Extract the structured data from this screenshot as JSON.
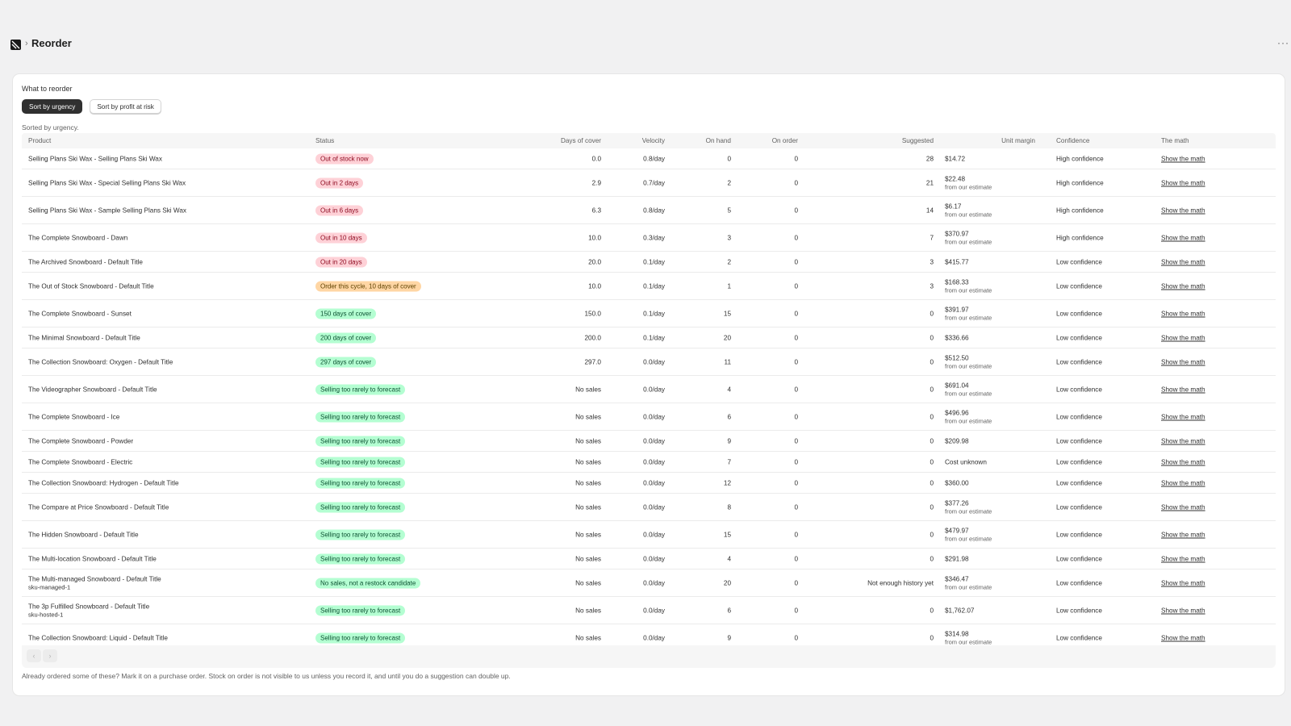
{
  "header": {
    "title": "Reorder",
    "separator": "›",
    "more": "···"
  },
  "card": {
    "title": "What to reorder",
    "sort_buttons": [
      "Sort by urgency",
      "Sort by profit at risk"
    ],
    "sorted_note": "Sorted by urgency.",
    "footer_note": "Already ordered some of these? Mark it on a purchase order. Stock on order is not visible to us unless you record it, and until you do a suggestion can double up."
  },
  "table": {
    "headers": {
      "product": "Product",
      "status": "Status",
      "days": "Days of cover",
      "velocity": "Velocity",
      "on_hand": "On hand",
      "on_order": "On order",
      "suggested": "Suggested",
      "margin": "Unit margin",
      "confidence": "Confidence",
      "math": "The math"
    },
    "rows": [
      {
        "product": "Selling Plans Ski Wax - Selling Plans Ski Wax",
        "sku": "",
        "status": "Out of stock now",
        "tone": "red",
        "days": "0.0",
        "velocity": "0.8/day",
        "on_hand": "0",
        "on_order": "0",
        "suggested": "28",
        "margin": "$14.72",
        "margin_sub": "",
        "confidence": "High confidence",
        "math": "Show the math"
      },
      {
        "product": "Selling Plans Ski Wax - Special Selling Plans Ski Wax",
        "sku": "",
        "status": "Out in 2 days",
        "tone": "red",
        "days": "2.9",
        "velocity": "0.7/day",
        "on_hand": "2",
        "on_order": "0",
        "suggested": "21",
        "margin": "$22.48",
        "margin_sub": "from our estimate",
        "confidence": "High confidence",
        "math": "Show the math"
      },
      {
        "product": "Selling Plans Ski Wax - Sample Selling Plans Ski Wax",
        "sku": "",
        "status": "Out in 6 days",
        "tone": "red",
        "days": "6.3",
        "velocity": "0.8/day",
        "on_hand": "5",
        "on_order": "0",
        "suggested": "14",
        "margin": "$6.17",
        "margin_sub": "from our estimate",
        "confidence": "High confidence",
        "math": "Show the math"
      },
      {
        "product": "The Complete Snowboard - Dawn",
        "sku": "",
        "status": "Out in 10 days",
        "tone": "red",
        "days": "10.0",
        "velocity": "0.3/day",
        "on_hand": "3",
        "on_order": "0",
        "suggested": "7",
        "margin": "$370.97",
        "margin_sub": "from our estimate",
        "confidence": "High confidence",
        "math": "Show the math"
      },
      {
        "product": "The Archived Snowboard - Default Title",
        "sku": "",
        "status": "Out in 20 days",
        "tone": "red",
        "days": "20.0",
        "velocity": "0.1/day",
        "on_hand": "2",
        "on_order": "0",
        "suggested": "3",
        "margin": "$415.77",
        "margin_sub": "",
        "confidence": "Low confidence",
        "math": "Show the math"
      },
      {
        "product": "The Out of Stock Snowboard - Default Title",
        "sku": "",
        "status": "Order this cycle, 10 days of cover",
        "tone": "orange",
        "days": "10.0",
        "velocity": "0.1/day",
        "on_hand": "1",
        "on_order": "0",
        "suggested": "3",
        "margin": "$168.33",
        "margin_sub": "from our estimate",
        "confidence": "Low confidence",
        "math": "Show the math"
      },
      {
        "product": "The Complete Snowboard - Sunset",
        "sku": "",
        "status": "150 days of cover",
        "tone": "green",
        "days": "150.0",
        "velocity": "0.1/day",
        "on_hand": "15",
        "on_order": "0",
        "suggested": "0",
        "margin": "$391.97",
        "margin_sub": "from our estimate",
        "confidence": "Low confidence",
        "math": "Show the math"
      },
      {
        "product": "The Minimal Snowboard - Default Title",
        "sku": "",
        "status": "200 days of cover",
        "tone": "green",
        "days": "200.0",
        "velocity": "0.1/day",
        "on_hand": "20",
        "on_order": "0",
        "suggested": "0",
        "margin": "$336.66",
        "margin_sub": "",
        "confidence": "Low confidence",
        "math": "Show the math"
      },
      {
        "product": "The Collection Snowboard: Oxygen - Default Title",
        "sku": "",
        "status": "297 days of cover",
        "tone": "green",
        "days": "297.0",
        "velocity": "0.0/day",
        "on_hand": "11",
        "on_order": "0",
        "suggested": "0",
        "margin": "$512.50",
        "margin_sub": "from our estimate",
        "confidence": "Low confidence",
        "math": "Show the math"
      },
      {
        "product": "The Videographer Snowboard - Default Title",
        "sku": "",
        "status": "Selling too rarely to forecast",
        "tone": "green",
        "days": "No sales",
        "velocity": "0.0/day",
        "on_hand": "4",
        "on_order": "0",
        "suggested": "0",
        "margin": "$691.04",
        "margin_sub": "from our estimate",
        "confidence": "Low confidence",
        "math": "Show the math"
      },
      {
        "product": "The Complete Snowboard - Ice",
        "sku": "",
        "status": "Selling too rarely to forecast",
        "tone": "green",
        "days": "No sales",
        "velocity": "0.0/day",
        "on_hand": "6",
        "on_order": "0",
        "suggested": "0",
        "margin": "$496.96",
        "margin_sub": "from our estimate",
        "confidence": "Low confidence",
        "math": "Show the math"
      },
      {
        "product": "The Complete Snowboard - Powder",
        "sku": "",
        "status": "Selling too rarely to forecast",
        "tone": "green",
        "days": "No sales",
        "velocity": "0.0/day",
        "on_hand": "9",
        "on_order": "0",
        "suggested": "0",
        "margin": "$209.98",
        "margin_sub": "",
        "confidence": "Low confidence",
        "math": "Show the math"
      },
      {
        "product": "The Complete Snowboard - Electric",
        "sku": "",
        "status": "Selling too rarely to forecast",
        "tone": "green",
        "days": "No sales",
        "velocity": "0.0/day",
        "on_hand": "7",
        "on_order": "0",
        "suggested": "0",
        "margin": "Cost unknown",
        "margin_sub": "",
        "confidence": "Low confidence",
        "math": "Show the math"
      },
      {
        "product": "The Collection Snowboard: Hydrogen - Default Title",
        "sku": "",
        "status": "Selling too rarely to forecast",
        "tone": "green",
        "days": "No sales",
        "velocity": "0.0/day",
        "on_hand": "12",
        "on_order": "0",
        "suggested": "0",
        "margin": "$360.00",
        "margin_sub": "",
        "confidence": "Low confidence",
        "math": "Show the math"
      },
      {
        "product": "The Compare at Price Snowboard - Default Title",
        "sku": "",
        "status": "Selling too rarely to forecast",
        "tone": "green",
        "days": "No sales",
        "velocity": "0.0/day",
        "on_hand": "8",
        "on_order": "0",
        "suggested": "0",
        "margin": "$377.26",
        "margin_sub": "from our estimate",
        "confidence": "Low confidence",
        "math": "Show the math"
      },
      {
        "product": "The Hidden Snowboard - Default Title",
        "sku": "",
        "status": "Selling too rarely to forecast",
        "tone": "green",
        "days": "No sales",
        "velocity": "0.0/day",
        "on_hand": "15",
        "on_order": "0",
        "suggested": "0",
        "margin": "$479.97",
        "margin_sub": "from our estimate",
        "confidence": "Low confidence",
        "math": "Show the math"
      },
      {
        "product": "The Multi-location Snowboard - Default Title",
        "sku": "",
        "status": "Selling too rarely to forecast",
        "tone": "green",
        "days": "No sales",
        "velocity": "0.0/day",
        "on_hand": "4",
        "on_order": "0",
        "suggested": "0",
        "margin": "$291.98",
        "margin_sub": "",
        "confidence": "Low confidence",
        "math": "Show the math"
      },
      {
        "product": "The Multi-managed Snowboard - Default Title",
        "sku": "sku-managed-1",
        "status": "No sales, not a restock candidate",
        "tone": "green",
        "days": "No sales",
        "velocity": "0.0/day",
        "on_hand": "20",
        "on_order": "0",
        "suggested": "Not enough history yet",
        "margin": "$346.47",
        "margin_sub": "from our estimate",
        "confidence": "Low confidence",
        "math": "Show the math"
      },
      {
        "product": "The 3p Fulfilled Snowboard - Default Title",
        "sku": "sku-hosted-1",
        "status": "Selling too rarely to forecast",
        "tone": "green",
        "days": "No sales",
        "velocity": "0.0/day",
        "on_hand": "6",
        "on_order": "0",
        "suggested": "0",
        "margin": "$1,762.07",
        "margin_sub": "",
        "confidence": "Low confidence",
        "math": "Show the math"
      },
      {
        "product": "The Collection Snowboard: Liquid - Default Title",
        "sku": "",
        "status": "Selling too rarely to forecast",
        "tone": "green",
        "days": "No sales",
        "velocity": "0.0/day",
        "on_hand": "9",
        "on_order": "0",
        "suggested": "0",
        "margin": "$314.98",
        "margin_sub": "from our estimate",
        "confidence": "Low confidence",
        "math": "Show the math"
      }
    ]
  },
  "pagination": {
    "prev": "‹",
    "next": "›"
  }
}
